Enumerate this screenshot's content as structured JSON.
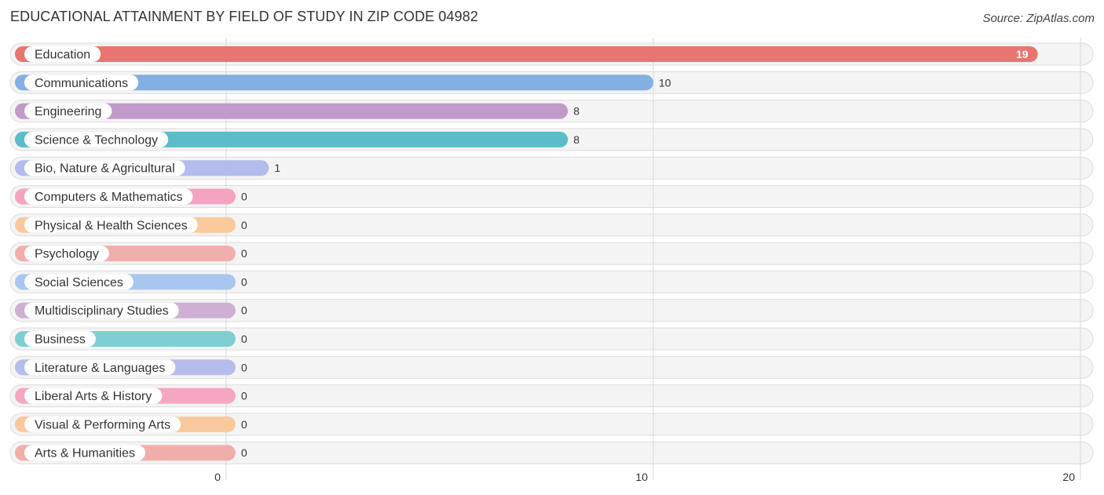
{
  "header": {
    "title": "EDUCATIONAL ATTAINMENT BY FIELD OF STUDY IN ZIP CODE 04982",
    "source": "Source: ZipAtlas.com"
  },
  "chart_data": {
    "type": "bar",
    "orientation": "horizontal",
    "title": "EDUCATIONAL ATTAINMENT BY FIELD OF STUDY IN ZIP CODE 04982",
    "xlabel": "",
    "ylabel": "",
    "xlim": [
      0,
      20
    ],
    "ticks": [
      0,
      10,
      20
    ],
    "tick_labels": [
      "0",
      "10",
      "20"
    ],
    "grid": true,
    "categories": [
      "Education",
      "Communications",
      "Engineering",
      "Science & Technology",
      "Bio, Nature & Agricultural",
      "Computers & Mathematics",
      "Physical & Health Sciences",
      "Psychology",
      "Social Sciences",
      "Multidisciplinary Studies",
      "Business",
      "Literature & Languages",
      "Liberal Arts & History",
      "Visual & Performing Arts",
      "Arts & Humanities"
    ],
    "values": [
      19,
      10,
      8,
      8,
      1,
      0,
      0,
      0,
      0,
      0,
      0,
      0,
      0,
      0,
      0
    ],
    "colors": [
      "#e8756f",
      "#82b0e2",
      "#c09ac8",
      "#5bbdc8",
      "#b3bcea",
      "#f4a3c0",
      "#f9c99c",
      "#f0aeac",
      "#a9c7ee",
      "#cdb0d4",
      "#7fcfd2",
      "#b7bdea",
      "#f5a6c2",
      "#f9c99d",
      "#f0aeab"
    ]
  }
}
